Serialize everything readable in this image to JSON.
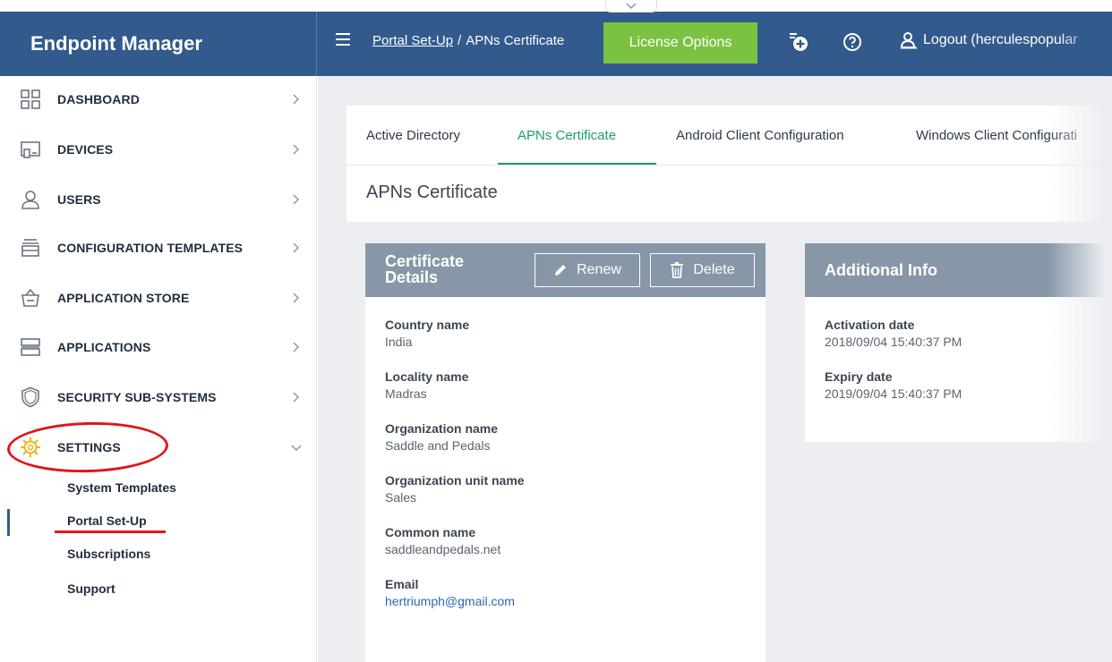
{
  "app": {
    "title": "Endpoint Manager"
  },
  "header": {
    "breadcrumb_parent": "Portal Set-Up",
    "breadcrumb_separator": "/",
    "breadcrumb_current": "APNs Certificate",
    "license_button": "License Options",
    "logout_label": "Logout (herculespopular",
    "accent_color": "#325a8c",
    "license_color": "#7cc242"
  },
  "sidebar": {
    "items": [
      {
        "label": "DASHBOARD",
        "icon": "dashboard-icon"
      },
      {
        "label": "DEVICES",
        "icon": "devices-icon"
      },
      {
        "label": "USERS",
        "icon": "user-icon"
      },
      {
        "label": "CONFIGURATION TEMPLATES",
        "icon": "templates-icon"
      },
      {
        "label": "APPLICATION STORE",
        "icon": "app-store-icon"
      },
      {
        "label": "APPLICATIONS",
        "icon": "applications-icon"
      },
      {
        "label": "SECURITY SUB-SYSTEMS",
        "icon": "shield-icon"
      },
      {
        "label": "SETTINGS",
        "icon": "gear-icon"
      }
    ],
    "settings_children": [
      {
        "label": "System Templates"
      },
      {
        "label": "Portal Set-Up"
      },
      {
        "label": "Subscriptions"
      },
      {
        "label": "Support"
      }
    ],
    "active_child": "Portal Set-Up",
    "highlight_color": "#e0151b"
  },
  "tabs": [
    {
      "label": "Active Directory"
    },
    {
      "label": "APNs Certificate"
    },
    {
      "label": "Android Client Configuration"
    },
    {
      "label": "Windows Client Configurati"
    }
  ],
  "active_tab": "APNs Certificate",
  "page": {
    "title": "APNs Certificate"
  },
  "certificate_details": {
    "title_line1": "Certificate",
    "title_line2": "Details",
    "renew_label": "Renew",
    "delete_label": "Delete",
    "fields": [
      {
        "label": "Country name",
        "value": "India"
      },
      {
        "label": "Locality name",
        "value": "Madras"
      },
      {
        "label": "Organization name",
        "value": "Saddle and Pedals"
      },
      {
        "label": "Organization unit name",
        "value": "Sales"
      },
      {
        "label": "Common name",
        "value": "saddleandpedals.net"
      },
      {
        "label": "Email",
        "value": "hertriumph@gmail.com"
      }
    ]
  },
  "additional_info": {
    "title": "Additional Info",
    "fields": [
      {
        "label": "Activation date",
        "value": "2018/09/04 15:40:37 PM"
      },
      {
        "label": "Expiry date",
        "value": "2019/09/04 15:40:37 PM"
      }
    ]
  }
}
